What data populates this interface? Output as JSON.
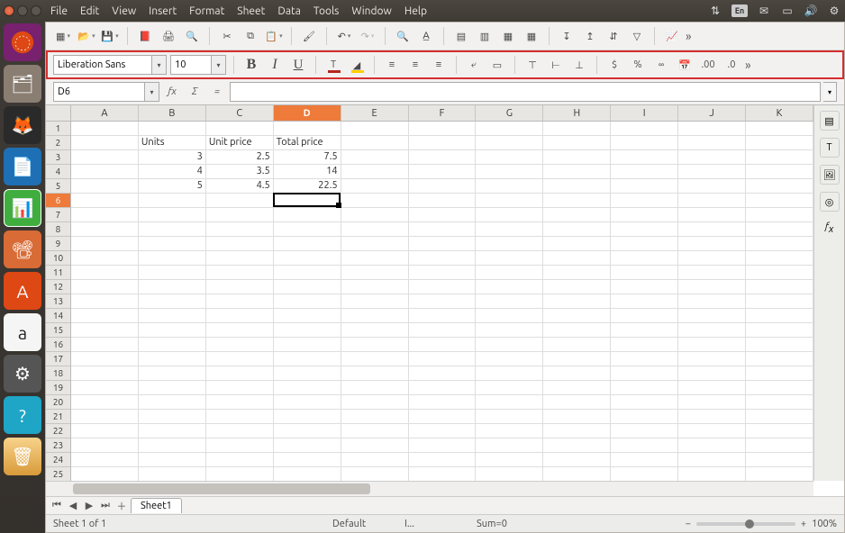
{
  "menubar": [
    "File",
    "Edit",
    "View",
    "Insert",
    "Format",
    "Sheet",
    "Data",
    "Tools",
    "Window",
    "Help"
  ],
  "panel": {
    "lang": "En"
  },
  "font": {
    "name": "Liberation Sans",
    "size": "10"
  },
  "namebox": "D6",
  "columns": [
    "A",
    "B",
    "C",
    "D",
    "E",
    "F",
    "G",
    "H",
    "I",
    "J",
    "K"
  ],
  "active_col_index": 3,
  "row_count": 26,
  "active_row": 6,
  "cells": {
    "B2": "Units",
    "C2": "Unit price",
    "D2": "Total price",
    "B3": "3",
    "C3": "2.5",
    "D3": "7.5",
    "B4": "4",
    "C4": "3.5",
    "D4": "14",
    "B5": "5",
    "C5": "4.5",
    "D5": "22.5"
  },
  "numeric_cells": [
    "B3",
    "C3",
    "D3",
    "B4",
    "C4",
    "D4",
    "B5",
    "C5",
    "D5"
  ],
  "cursor": {
    "col": 3,
    "row": 6
  },
  "tabs": {
    "sheet1": "Sheet1"
  },
  "status": {
    "sheet": "Sheet 1 of 1",
    "style": "Default",
    "insert": "I...",
    "sum": "Sum=0",
    "zoom": "100%"
  },
  "chart_data": {
    "type": "table",
    "columns": [
      "Units",
      "Unit price",
      "Total price"
    ],
    "rows": [
      [
        3,
        2.5,
        7.5
      ],
      [
        4,
        3.5,
        14
      ],
      [
        5,
        4.5,
        22.5
      ]
    ]
  }
}
